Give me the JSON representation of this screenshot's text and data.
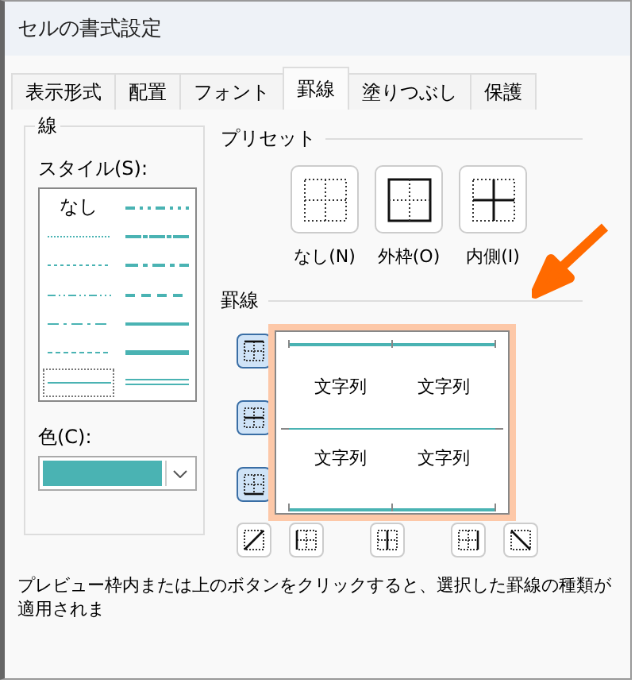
{
  "window": {
    "title": "セルの書式設定"
  },
  "tabs": [
    {
      "label": "表示形式",
      "selected": false
    },
    {
      "label": "配置",
      "selected": false
    },
    {
      "label": "フォント",
      "selected": false
    },
    {
      "label": "罫線",
      "selected": true
    },
    {
      "label": "塗りつぶし",
      "selected": false
    },
    {
      "label": "保護",
      "selected": false
    }
  ],
  "line": {
    "title": "線",
    "style_label": "スタイル(S):",
    "styles": [
      {
        "kind": "none",
        "label": "なし",
        "selected": false
      },
      {
        "kind": "hair",
        "selected": false
      },
      {
        "kind": "dotted",
        "selected": false
      },
      {
        "kind": "dash-dot-dot",
        "selected": false
      },
      {
        "kind": "dash-dot",
        "selected": false
      },
      {
        "kind": "dashed",
        "selected": false
      },
      {
        "kind": "thin",
        "selected": true
      },
      {
        "kind": "medium-dash-dot-dot",
        "selected": false
      },
      {
        "kind": "slant-dash-dot",
        "selected": false
      },
      {
        "kind": "medium-dash-dot",
        "selected": false
      },
      {
        "kind": "medium-dashed",
        "selected": false
      },
      {
        "kind": "medium",
        "selected": false
      },
      {
        "kind": "thick",
        "selected": false
      },
      {
        "kind": "double",
        "selected": false
      }
    ],
    "color_label": "色(C):",
    "color": "#4ab3b3"
  },
  "presets": {
    "title": "プリセット",
    "buttons": [
      {
        "kind": "none",
        "label": "なし(N)"
      },
      {
        "kind": "outline",
        "label": "外枠(O)"
      },
      {
        "kind": "inside",
        "label": "内側(I)"
      }
    ]
  },
  "border": {
    "title": "罫線",
    "side_buttons": [
      {
        "kind": "top",
        "selected": true
      },
      {
        "kind": "middle",
        "selected": true
      },
      {
        "kind": "bottom",
        "selected": true
      }
    ],
    "bottom_buttons": [
      {
        "kind": "diagonal-up",
        "selected": false
      },
      {
        "kind": "left",
        "selected": false
      },
      {
        "kind": "center",
        "selected": false
      },
      {
        "kind": "right",
        "selected": false
      },
      {
        "kind": "diagonal-down",
        "selected": false
      }
    ],
    "preview_cells": [
      "文字列",
      "文字列",
      "文字列",
      "文字列"
    ]
  },
  "hint": "プレビュー枠内または上のボタンをクリックすると、選択した罫線の種類が適用されま"
}
